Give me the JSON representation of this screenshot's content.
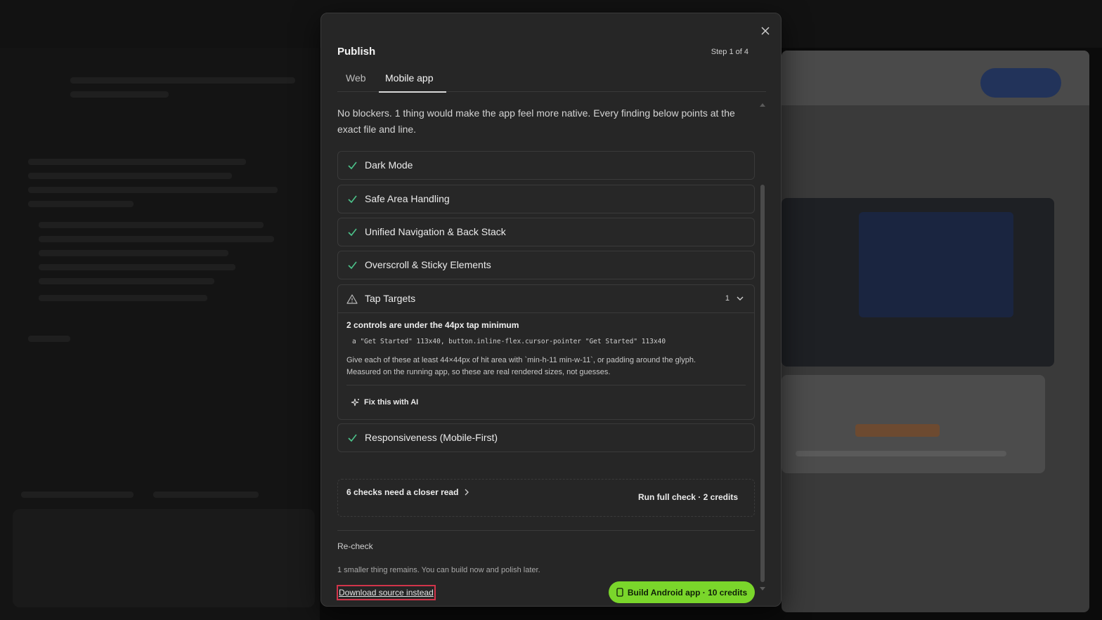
{
  "modal": {
    "title": "Publish",
    "step": "Step 1 of 4",
    "tabs": [
      {
        "label": "Web"
      },
      {
        "label": "Mobile app"
      }
    ],
    "intro": "No blockers. 1 thing would make the app feel more native. Every finding below points at the exact file and line.",
    "checks": [
      {
        "label": "Dark Mode",
        "status": "pass"
      },
      {
        "label": "Safe Area Handling",
        "status": "pass"
      },
      {
        "label": "Unified Navigation & Back Stack",
        "status": "pass"
      },
      {
        "label": "Overscroll & Sticky Elements",
        "status": "pass"
      },
      {
        "label": "Tap Targets",
        "status": "warning",
        "count": "1"
      },
      {
        "label": "Responsiveness (Mobile-First)",
        "status": "pass"
      }
    ],
    "finding": {
      "title": "2 controls are under the 44px tap minimum",
      "code": "a \"Get Started\" 113x40, button.inline-flex.cursor-pointer \"Get Started\" 113x40",
      "desc_line1": "Give each of these at least 44×44px of hit area with `min-h-11 min-w-11`, or padding around the glyph.",
      "desc_line2": "Measured on the running app, so these are real rendered sizes, not guesses.",
      "fix_label": "Fix this with AI"
    },
    "closer": {
      "label": "6 checks need a closer read",
      "run_label": "Run full check · 2 credits"
    },
    "recheck": "Re-check",
    "remains": "1 smaller thing remains. You can build now and polish later.",
    "download": "Download source instead",
    "build": "Build Android app · 10 credits"
  },
  "colors": {
    "accent_green": "#7ad62b",
    "pass_check": "#4cc38a",
    "highlight_red": "#d2344a"
  }
}
